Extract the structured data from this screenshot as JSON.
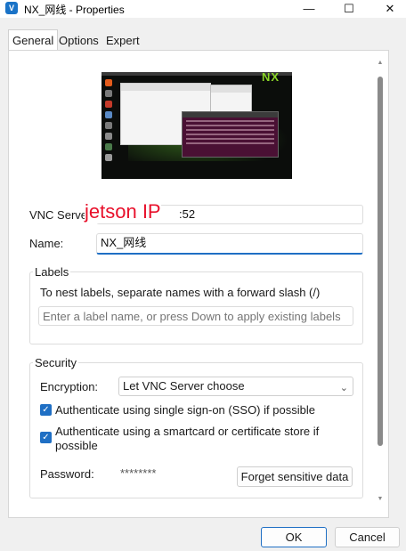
{
  "window": {
    "title": "NX_网线 - Properties",
    "app_icon": "V",
    "minimize": "—",
    "maximize": "☐",
    "close": "✕"
  },
  "tabs": [
    {
      "label": "General",
      "active": true
    },
    {
      "label": "Options",
      "active": false
    },
    {
      "label": "Expert",
      "active": false
    }
  ],
  "thumbnail": {
    "desktop_logo": "NX"
  },
  "server": {
    "label": "VNC Server:",
    "overlay_text": "jetson IP",
    "value_suffix": ":52"
  },
  "name": {
    "label": "Name:",
    "value": "NX_网线"
  },
  "labels_group": {
    "title": "Labels",
    "help": "To nest labels, separate names with a forward slash (/)",
    "placeholder": "Enter a label name, or press Down to apply existing labels"
  },
  "security": {
    "title": "Security",
    "encryption_label": "Encryption:",
    "encryption_value": "Let VNC Server choose",
    "sso_label": "Authenticate using single sign-on (SSO) if possible",
    "smartcard_label_line1": "Authenticate using a smartcard or certificate store if",
    "smartcard_label_line2": "possible",
    "password_label": "Password:",
    "password_value": "********",
    "forget_button": "Forget sensitive data"
  },
  "footer": {
    "ok": "OK",
    "cancel": "Cancel"
  },
  "colors": {
    "accent": "#1f6fc4",
    "overlay_red": "#e8102b"
  }
}
